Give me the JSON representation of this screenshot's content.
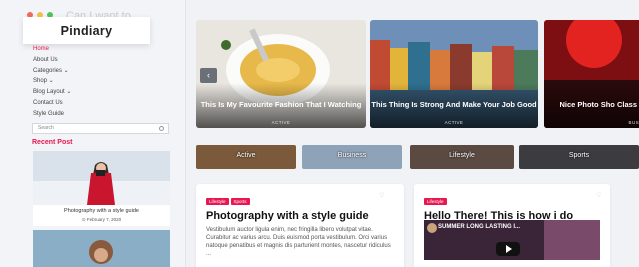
{
  "window": {
    "ghost_text": "Can I want to"
  },
  "colors": {
    "accent": "#e8174f",
    "dot_red": "#f26b5b",
    "dot_yellow": "#f5c04a",
    "dot_green": "#4fc45d"
  },
  "sidebar": {
    "logo": "Pindiary",
    "menu": [
      "Home",
      "About Us",
      "Categories ⌄",
      "Shop ⌄",
      "Blog Layout ⌄",
      "Contact Us",
      "Style Guide"
    ],
    "search_placeholder": "Search",
    "recent_title": "Recent Post",
    "recent_post": {
      "caption": "Photography with a style guide",
      "date": "⊙ February 7, 2020"
    }
  },
  "slider": {
    "slides": [
      {
        "title": "This Is My Favourite Fashion That I Watching",
        "tag": "ACTIVE"
      },
      {
        "title": "This Thing Is Strong And Make Your Job Good",
        "tag": "ACTIVE"
      },
      {
        "title": "Nice Photo Sho Class",
        "tag": "BUS"
      }
    ],
    "prev_icon": "‹"
  },
  "categories": [
    "Active",
    "Business",
    "Lifestyle",
    "Sports"
  ],
  "posts": [
    {
      "badges": [
        "Lifestyle",
        "Sports"
      ],
      "title": "Photography with a style guide",
      "body": "Vestibulum auctor ligula enim, nec fringilla libero volutpat vitae. Curabitur ac varius arcu. Duis euismod porta vestibulum. Orci varius natoque penatibus et magnis dis parturient montes, nascetur ridiculus ..."
    },
    {
      "badges": [
        "Lifestyle"
      ],
      "title": "Hello There! This is how i do Makeup",
      "video_title": "SUMMER LONG LASTING I..."
    }
  ]
}
